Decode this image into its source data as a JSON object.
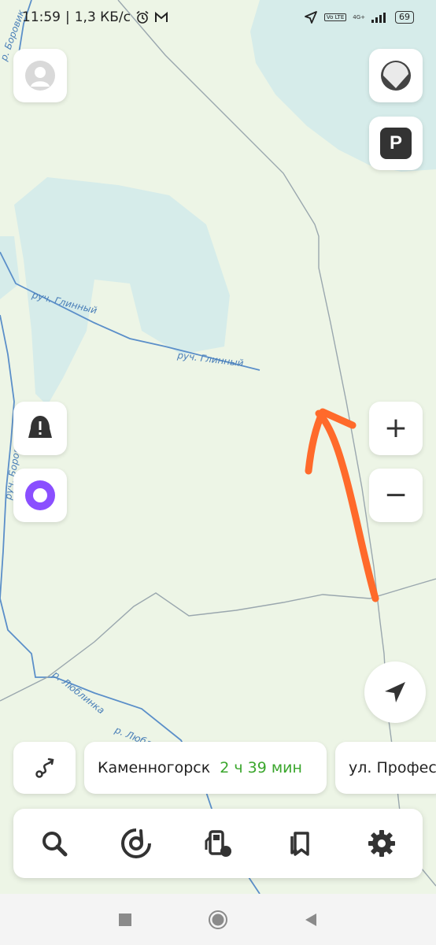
{
  "status_bar": {
    "time": "11:59",
    "speed": "1,3 КБ/с",
    "network_badge": "Vo LTE",
    "generation": "4G+",
    "battery": "69"
  },
  "map": {
    "labels": {
      "stream_1": "руч. Глинный",
      "stream_2": "руч. Глинный",
      "borovik_top": "р. Боровик",
      "borovik_side": "руч. Боровик",
      "lyublinka": "р. Люблинка",
      "lyublinka_2": "р. Люблинка"
    },
    "colors": {
      "land": "#edf5e6",
      "water": "#d6ecea",
      "river": "#5b8fc9",
      "road": "#9aa7ae",
      "arrow": "#ff6a2b"
    }
  },
  "controls": {
    "profile_icon": "user-avatar-icon",
    "layers_icon": "map-layers-icon",
    "parking_label": "P",
    "alert_label": "!",
    "zoom_in_label": "+",
    "zoom_out_label": "−"
  },
  "route": {
    "destination": "Каменногорск",
    "eta": "2 ч 39 мин",
    "next_street": "ул. Профес"
  },
  "bottom_bar": {
    "items": [
      "search-icon",
      "music-icon",
      "fuel-icon",
      "bookmarks-icon",
      "settings-icon"
    ]
  },
  "navbar": {
    "items": [
      "recents-icon",
      "home-icon",
      "back-icon"
    ]
  }
}
